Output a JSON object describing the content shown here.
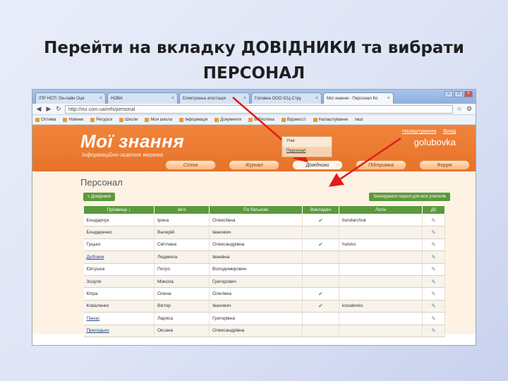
{
  "slide": {
    "title_line1": "Перейти на вкладку ДОВІДНИКИ та вибрати",
    "title_line2": "ПЕРСОНАЛ"
  },
  "browser": {
    "tabs": [
      {
        "label": "ІПР НСП: Он-лайн Оця",
        "active": false
      },
      {
        "label": "НОВА",
        "active": false
      },
      {
        "label": "Електронна атестація",
        "active": false
      },
      {
        "label": "Головна ООО ІСЦ-Стру",
        "active": false
      },
      {
        "label": "Мої знання - Персонал Ко",
        "active": true
      }
    ],
    "url": "http://mz.com.ua/refs/personal",
    "bookmarks": [
      "Оптима",
      "Новини",
      "Ресурси",
      "Школи",
      "Моя школа",
      "Інформація",
      "Документи",
      "Бібліотека",
      "Відомості",
      "Налаштування",
      "Інші"
    ]
  },
  "site": {
    "logo": "Мої знання",
    "tagline": "Інформаційно-освітня мережа",
    "user_links": [
      "Налаштування",
      "Вихід"
    ],
    "username": "golubovka",
    "nav": [
      "Стіна",
      "Журнал",
      "Довідники",
      "Підтримка",
      "Форум"
    ],
    "dropdown": [
      "Учні",
      "Персонал"
    ],
    "page_title": "Персонал",
    "back_button": "« Довідники",
    "generate_button": "Згенерувати паролі для всіх учителів",
    "table": {
      "headers": [
        "Прізвище ↕",
        "Ім'я",
        "По батькові",
        "Викладач",
        "Логін",
        "Дії"
      ],
      "rows": [
        [
          "Бондарчук",
          "Ірина",
          "Олексіївна",
          "✔",
          "bondarchuk",
          "✎"
        ],
        [
          "Бондаренко",
          "Валерій",
          "Іванович",
          "",
          "",
          "✎"
        ],
        [
          "Гуцько",
          "Світлана",
          "Олександрівна",
          "✔",
          "hutsko",
          "✎"
        ],
        [
          "Дубовик",
          "Людмила",
          "Іванівна",
          "",
          "",
          "✎"
        ],
        [
          "Євтушок",
          "Петро",
          "Володимирович",
          "",
          "",
          "✎"
        ],
        [
          "Зозуля",
          "Микола",
          "Григорович",
          "",
          "",
          "✎"
        ],
        [
          "Кіпра",
          "Олена",
          "Олегівна",
          "✔",
          "",
          "✎"
        ],
        [
          "Коваленко",
          "Віктор",
          "Іванович",
          "✔",
          "kovalenko",
          "✎"
        ],
        [
          "Панас",
          "Лариса",
          "Григорівна",
          "",
          "",
          "✎"
        ],
        [
          "Приходько",
          "Оксана",
          "Олександрівна",
          "",
          "",
          "✎"
        ]
      ]
    }
  },
  "colors": {
    "header_orange": "#e8722a",
    "accent_green": "#5b9a3c",
    "arrow_red": "#e31b1b"
  }
}
